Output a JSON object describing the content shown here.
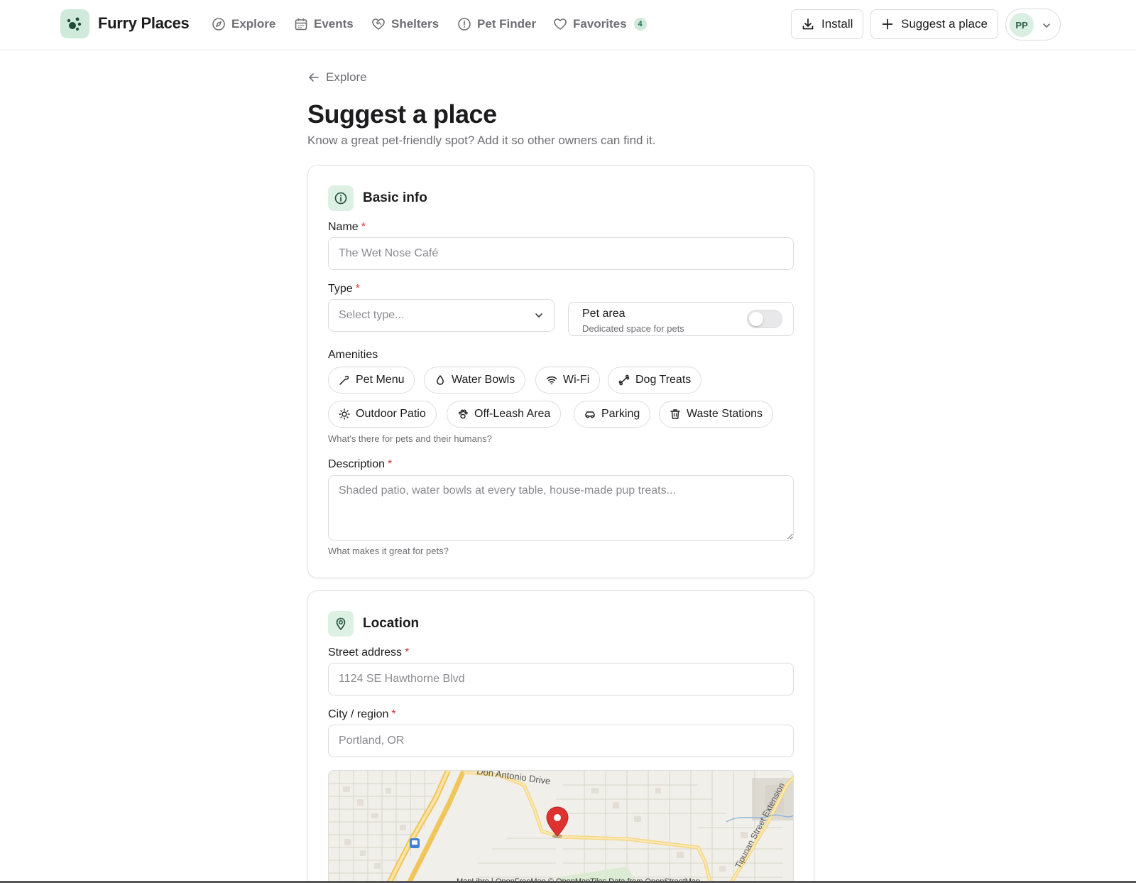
{
  "app": {
    "name": "Furry Places"
  },
  "nav": {
    "items": [
      {
        "label": "Explore",
        "icon": "compass-icon"
      },
      {
        "label": "Events",
        "icon": "calendar-icon"
      },
      {
        "label": "Shelters",
        "icon": "heart-handshake-icon"
      },
      {
        "label": "Pet Finder",
        "icon": "alert-circle-icon"
      },
      {
        "label": "Favorites",
        "icon": "heart-icon",
        "badge": "4"
      }
    ]
  },
  "header": {
    "install_label": "Install",
    "suggest_label": "Suggest a place",
    "user_initials": "PP"
  },
  "page": {
    "back_label": "Explore",
    "title": "Suggest a place",
    "subtitle": "Know a great pet-friendly spot? Add it so other owners can find it."
  },
  "basic_info": {
    "title": "Basic info",
    "name_label": "Name",
    "name_placeholder": "The Wet Nose Café",
    "type_label": "Type",
    "type_placeholder": "Select type...",
    "pet_area_title": "Pet area",
    "pet_area_sub": "Dedicated space for pets",
    "pet_area_on": false,
    "amenities_label": "Amenities",
    "amenities": [
      {
        "label": "Pet Menu",
        "icon": "pet-menu-icon"
      },
      {
        "label": "Water Bowls",
        "icon": "droplet-icon"
      },
      {
        "label": "Wi-Fi",
        "icon": "wifi-icon"
      },
      {
        "label": "Dog Treats",
        "icon": "bone-icon"
      },
      {
        "label": "Outdoor Patio",
        "icon": "sun-icon"
      },
      {
        "label": "Off-Leash Area",
        "icon": "paw-icon"
      },
      {
        "label": "Parking",
        "icon": "car-icon"
      },
      {
        "label": "Waste Stations",
        "icon": "trash-icon"
      }
    ],
    "amenities_help": "What's there for pets and their humans?",
    "description_label": "Description",
    "description_placeholder": "Shaded patio, water bowls at every table, house-made pup treats...",
    "description_help": "What makes it great for pets?"
  },
  "location": {
    "title": "Location",
    "street_label": "Street address",
    "street_placeholder": "1124 SE Hawthorne Blvd",
    "city_label": "City / region",
    "city_placeholder": "Portland, OR",
    "map": {
      "road_label_1": "Don Antonio Drive",
      "road_label_2": "Tipunan Street Extension",
      "attribution": "MapLibre | OpenFreeMap © OpenMapTiles Data from OpenStreetMap"
    }
  },
  "colors": {
    "accent": "#cfe9db",
    "accent_dark": "#2e6b4a",
    "required": "#d93636",
    "pin": "#e03131"
  }
}
